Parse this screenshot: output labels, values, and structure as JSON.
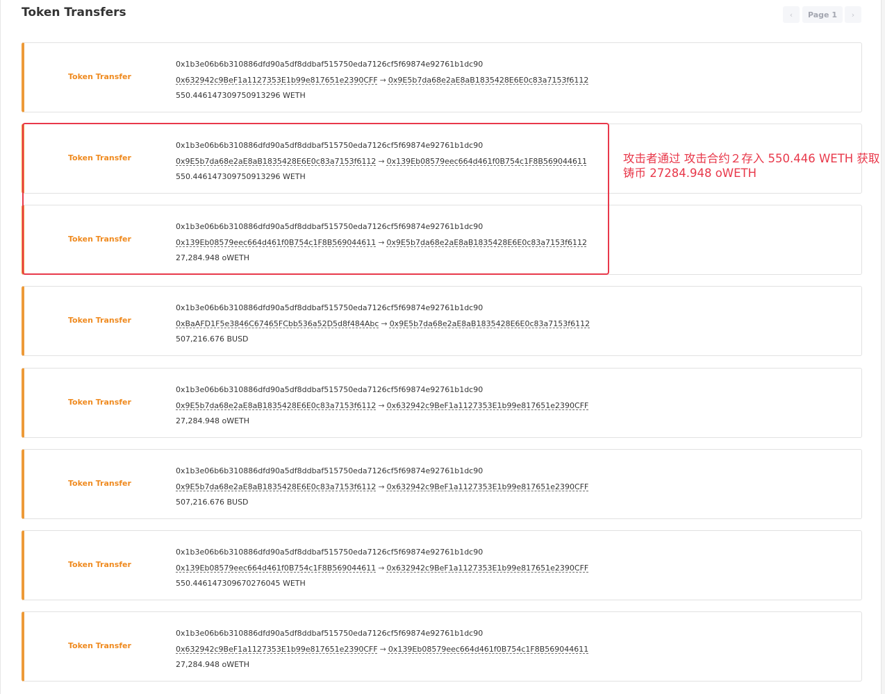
{
  "page": {
    "title": "Token Transfers"
  },
  "pagination": {
    "prev_icon": "chevron-left-icon",
    "next_icon": "chevron-right-icon",
    "prev_glyph": "‹",
    "next_glyph": "›",
    "label": "Page 1"
  },
  "colors": {
    "accent": "#ed9a38",
    "type_label": "#ef8a1f",
    "annotation": "#e8384a"
  },
  "transfers": [
    {
      "type": "Token Transfer",
      "tx_hash": "0x1b3e06b6b310886dfd90a5df8ddbaf515750eda7126cf5f69874e92761b1dc90",
      "from": "0x632942c9BeF1a1127353E1b99e817651e2390CFF",
      "arrow": "→",
      "to": "0x9E5b7da68e2aE8aB1835428E6E0c83a7153f6112",
      "amount": "550.446147309750913296 WETH"
    },
    {
      "type": "Token Transfer",
      "tx_hash": "0x1b3e06b6b310886dfd90a5df8ddbaf515750eda7126cf5f69874e92761b1dc90",
      "from": "0x9E5b7da68e2aE8aB1835428E6E0c83a7153f6112",
      "arrow": "→",
      "to": "0x139Eb08579eec664d461f0B754c1F8B569044611",
      "amount": "550.446147309750913296 WETH"
    },
    {
      "type": "Token Transfer",
      "tx_hash": "0x1b3e06b6b310886dfd90a5df8ddbaf515750eda7126cf5f69874e92761b1dc90",
      "from": "0x139Eb08579eec664d461f0B754c1F8B569044611",
      "arrow": "→",
      "to": "0x9E5b7da68e2aE8aB1835428E6E0c83a7153f6112",
      "amount": "27,284.948 oWETH"
    },
    {
      "type": "Token Transfer",
      "tx_hash": "0x1b3e06b6b310886dfd90a5df8ddbaf515750eda7126cf5f69874e92761b1dc90",
      "from": "0xBaAFD1F5e3846C67465FCbb536a52D5d8f484Abc",
      "arrow": "→",
      "to": "0x9E5b7da68e2aE8aB1835428E6E0c83a7153f6112",
      "amount": "507,216.676 BUSD"
    },
    {
      "type": "Token Transfer",
      "tx_hash": "0x1b3e06b6b310886dfd90a5df8ddbaf515750eda7126cf5f69874e92761b1dc90",
      "from": "0x9E5b7da68e2aE8aB1835428E6E0c83a7153f6112",
      "arrow": "→",
      "to": "0x632942c9BeF1a1127353E1b99e817651e2390CFF",
      "amount": "27,284.948 oWETH"
    },
    {
      "type": "Token Transfer",
      "tx_hash": "0x1b3e06b6b310886dfd90a5df8ddbaf515750eda7126cf5f69874e92761b1dc90",
      "from": "0x9E5b7da68e2aE8aB1835428E6E0c83a7153f6112",
      "arrow": "→",
      "to": "0x632942c9BeF1a1127353E1b99e817651e2390CFF",
      "amount": "507,216.676 BUSD"
    },
    {
      "type": "Token Transfer",
      "tx_hash": "0x1b3e06b6b310886dfd90a5df8ddbaf515750eda7126cf5f69874e92761b1dc90",
      "from": "0x139Eb08579eec664d461f0B754c1F8B569044611",
      "arrow": "→",
      "to": "0x632942c9BeF1a1127353E1b99e817651e2390CFF",
      "amount": "550.446147309670276045 WETH"
    },
    {
      "type": "Token Transfer",
      "tx_hash": "0x1b3e06b6b310886dfd90a5df8ddbaf515750eda7126cf5f69874e92761b1dc90",
      "from": "0x632942c9BeF1a1127353E1b99e817651e2390CFF",
      "arrow": "→",
      "to": "0x139Eb08579eec664d461f0B754c1F8B569044611",
      "amount": "27,284.948 oWETH"
    }
  ],
  "annotation": {
    "text": "攻击者通过 攻击合约２存入 550.446 WETH 获取铸币 27284.948 oWETH"
  }
}
